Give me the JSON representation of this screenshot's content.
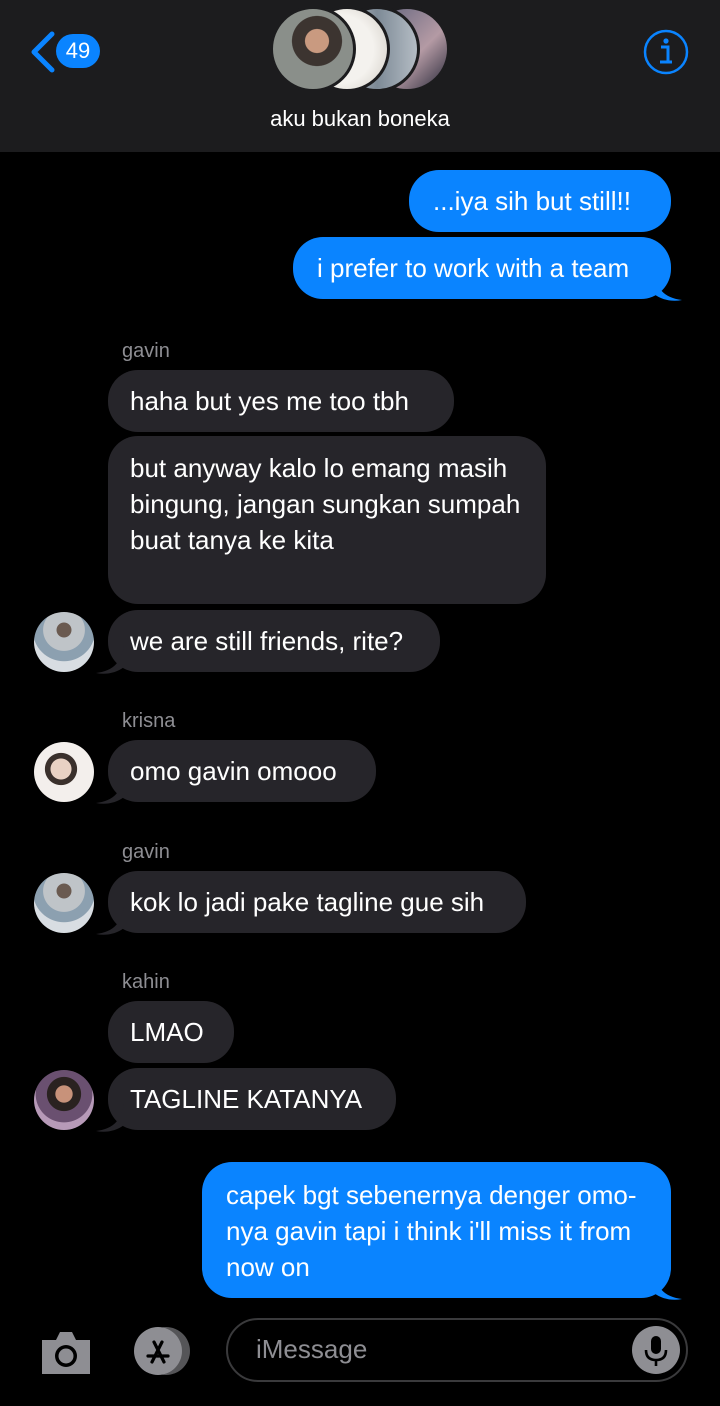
{
  "header": {
    "back_badge": "49",
    "group_name": "aku bukan boneka"
  },
  "messages": [
    {
      "text": "...iya sih but still!!"
    },
    {
      "text": "i prefer to work with a team"
    },
    {
      "sender": "gavin"
    },
    {
      "text": "haha but yes me too tbh"
    },
    {
      "text": "but anyway kalo lo emang masih bingung, jangan sungkan sumpah buat tanya ke kita"
    },
    {
      "text": "we are still friends, rite?"
    },
    {
      "sender": "krisna"
    },
    {
      "text": "omo gavin omooo"
    },
    {
      "sender": "gavin"
    },
    {
      "text": "kok lo jadi pake tagline gue sih"
    },
    {
      "sender": "kahin"
    },
    {
      "text": "LMAO"
    },
    {
      "text": "TAGLINE KATANYA"
    },
    {
      "text": "capek bgt sebenernya denger omo-nya gavin tapi i think i'll miss it from now on"
    }
  ],
  "composer": {
    "placeholder": "iMessage"
  },
  "colors": {
    "outgoing": "#0a84ff",
    "incoming": "#26252a",
    "header_bg": "#1c1c1e"
  },
  "icons": [
    "back-chevron-icon",
    "info-icon",
    "camera-icon",
    "app-store-icon",
    "microphone-icon"
  ]
}
